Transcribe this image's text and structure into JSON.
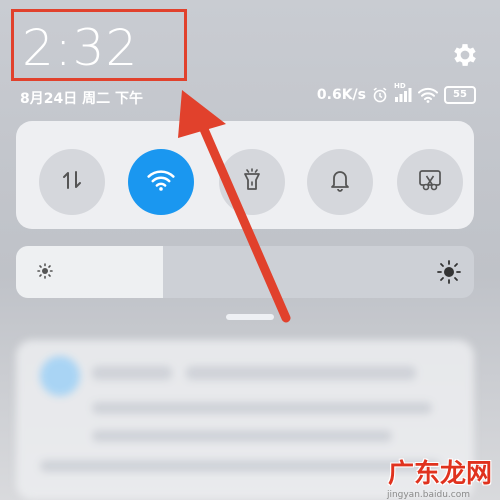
{
  "status_bar": {
    "time": "2:32",
    "date": "8月24日 周二 下午",
    "net_speed": "0.6K/s",
    "hd_label": "HD",
    "battery": "55"
  },
  "quick_tiles": [
    {
      "name": "data-toggle",
      "icon": "mobile-data-icon",
      "active": false
    },
    {
      "name": "wifi-toggle",
      "icon": "wifi-icon",
      "active": true
    },
    {
      "name": "flashlight-toggle",
      "icon": "flashlight-icon",
      "active": false
    },
    {
      "name": "sound-toggle",
      "icon": "bell-icon",
      "active": false
    },
    {
      "name": "screenshot-toggle",
      "icon": "scissors-icon",
      "active": false
    }
  ],
  "brightness": {
    "level": 0.32
  },
  "colors": {
    "highlight": "#e1412c",
    "active_tile": "#1a97f0",
    "watermark": "#e0321e"
  },
  "watermark": {
    "title": "广东龙网",
    "subtitle": "jingyan.baidu.com"
  }
}
